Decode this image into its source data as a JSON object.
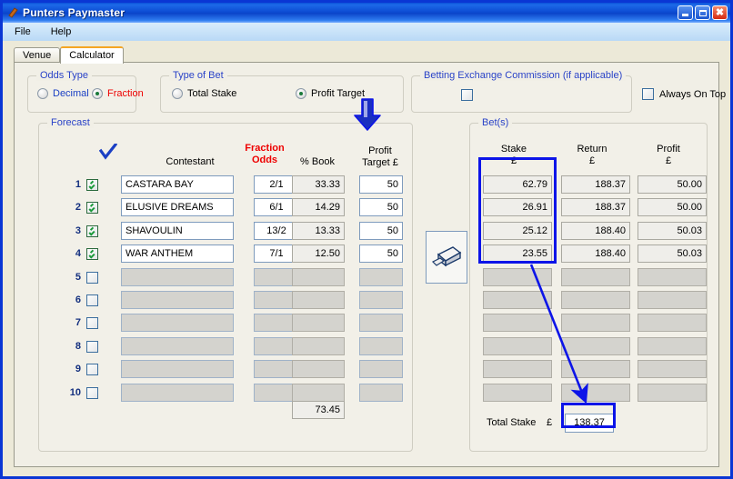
{
  "window": {
    "title": "Punters Paymaster",
    "icon": "app-icon",
    "buttons": {
      "minimize": "minimize",
      "maximize": "restore",
      "close": "close"
    }
  },
  "menu": {
    "items": [
      "File",
      "Help"
    ]
  },
  "tabs": [
    {
      "label": "Venue",
      "active": false
    },
    {
      "label": "Calculator",
      "active": true
    }
  ],
  "odds_type": {
    "legend": "Odds Type",
    "options": [
      {
        "label": "Decimal",
        "selected": false,
        "color": "#1a3fc4"
      },
      {
        "label": "Fraction",
        "selected": true,
        "color": "#ee0000"
      }
    ]
  },
  "type_of_bet": {
    "legend": "Type of Bet",
    "options": [
      {
        "label": "Total Stake",
        "selected": false
      },
      {
        "label": "Profit Target",
        "selected": true
      }
    ]
  },
  "commission": {
    "legend": "Betting Exchange Commission (if applicable)",
    "checked": false
  },
  "always_on_top": {
    "label": "Always On Top",
    "checked": false
  },
  "forecast": {
    "legend": "Forecast",
    "headers": {
      "select": "check-all-icon",
      "contestant": "Contestant",
      "odds_line1": "Fraction",
      "odds_line2": "Odds",
      "book": "% Book",
      "target_line1": "Profit",
      "target_line2": "Target £"
    },
    "rows": [
      {
        "num": "1",
        "checked": true,
        "contestant": "CASTARA BAY",
        "odds": "2/1",
        "book": "33.33",
        "target": "50"
      },
      {
        "num": "2",
        "checked": true,
        "contestant": "ELUSIVE DREAMS",
        "odds": "6/1",
        "book": "14.29",
        "target": "50"
      },
      {
        "num": "3",
        "checked": true,
        "contestant": "SHAVOULIN",
        "odds": "13/2",
        "book": "13.33",
        "target": "50"
      },
      {
        "num": "4",
        "checked": true,
        "contestant": "WAR ANTHEM",
        "odds": "7/1",
        "book": "12.50",
        "target": "50"
      },
      {
        "num": "5",
        "checked": false,
        "contestant": "",
        "odds": "",
        "book": "",
        "target": ""
      },
      {
        "num": "6",
        "checked": false,
        "contestant": "",
        "odds": "",
        "book": "",
        "target": ""
      },
      {
        "num": "7",
        "checked": false,
        "contestant": "",
        "odds": "",
        "book": "",
        "target": ""
      },
      {
        "num": "8",
        "checked": false,
        "contestant": "",
        "odds": "",
        "book": "",
        "target": ""
      },
      {
        "num": "9",
        "checked": false,
        "contestant": "",
        "odds": "",
        "book": "",
        "target": ""
      },
      {
        "num": "10",
        "checked": false,
        "contestant": "",
        "odds": "",
        "book": "",
        "target": ""
      }
    ],
    "book_total": "73.45"
  },
  "calc_button": {
    "icon": "calculator-icon"
  },
  "bets": {
    "legend": "Bet(s)",
    "headers": {
      "stake_line1": "Stake",
      "stake_line2": "£",
      "return_line1": "Return",
      "return_line2": "£",
      "profit_line1": "Profit",
      "profit_line2": "£"
    },
    "rows": [
      {
        "stake": "62.79",
        "return": "188.37",
        "profit": "50.00"
      },
      {
        "stake": "26.91",
        "return": "188.37",
        "profit": "50.00"
      },
      {
        "stake": "25.12",
        "return": "188.40",
        "profit": "50.03"
      },
      {
        "stake": "23.55",
        "return": "188.40",
        "profit": "50.03"
      },
      {
        "stake": "",
        "return": "",
        "profit": ""
      },
      {
        "stake": "",
        "return": "",
        "profit": ""
      },
      {
        "stake": "",
        "return": "",
        "profit": ""
      },
      {
        "stake": "",
        "return": "",
        "profit": ""
      },
      {
        "stake": "",
        "return": "",
        "profit": ""
      },
      {
        "stake": "",
        "return": "",
        "profit": ""
      }
    ],
    "total_label": "Total Stake",
    "total_currency": "£",
    "total_value": "138.37"
  },
  "annotations": {
    "color": "#0c14e8",
    "arrow_down_target": "profit-target-column",
    "stake_highlight": "stake-column",
    "total_highlight": "total-stake-value",
    "arrow_diagonal": "stake-to-total"
  },
  "colors": {
    "accent_blue": "#0a36d4",
    "legend_blue": "#2a43c8",
    "red": "#ee0000",
    "annotation": "#0c14e8",
    "face": "#ece9d8"
  }
}
